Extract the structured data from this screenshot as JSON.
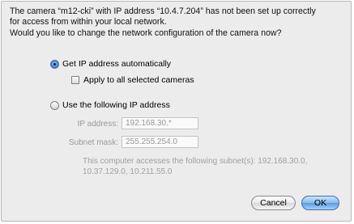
{
  "dialog": {
    "message_lines": [
      "The camera “m12-cki” with IP address “10.4.7.204” has not been set up correctly",
      "for access from within your local network.",
      "Would you like to change the network configuration of the camera now?"
    ],
    "option_auto_label": "Get IP address automatically",
    "option_auto_selected": true,
    "apply_all_label": "Apply to all selected cameras",
    "apply_all_checked": false,
    "option_manual_label": "Use the following IP address",
    "option_manual_selected": false,
    "ip_label": "IP address:",
    "ip_value": "192.168.30.*",
    "subnet_label": "Subnet mask:",
    "subnet_value": "255.255.254.0",
    "info_lines": [
      "This computer accesses the following subnet(s): 192.168.30.0,",
      "10.37.129.0, 10.211.55.0"
    ],
    "cancel_label": "Cancel",
    "ok_label": "OK"
  }
}
